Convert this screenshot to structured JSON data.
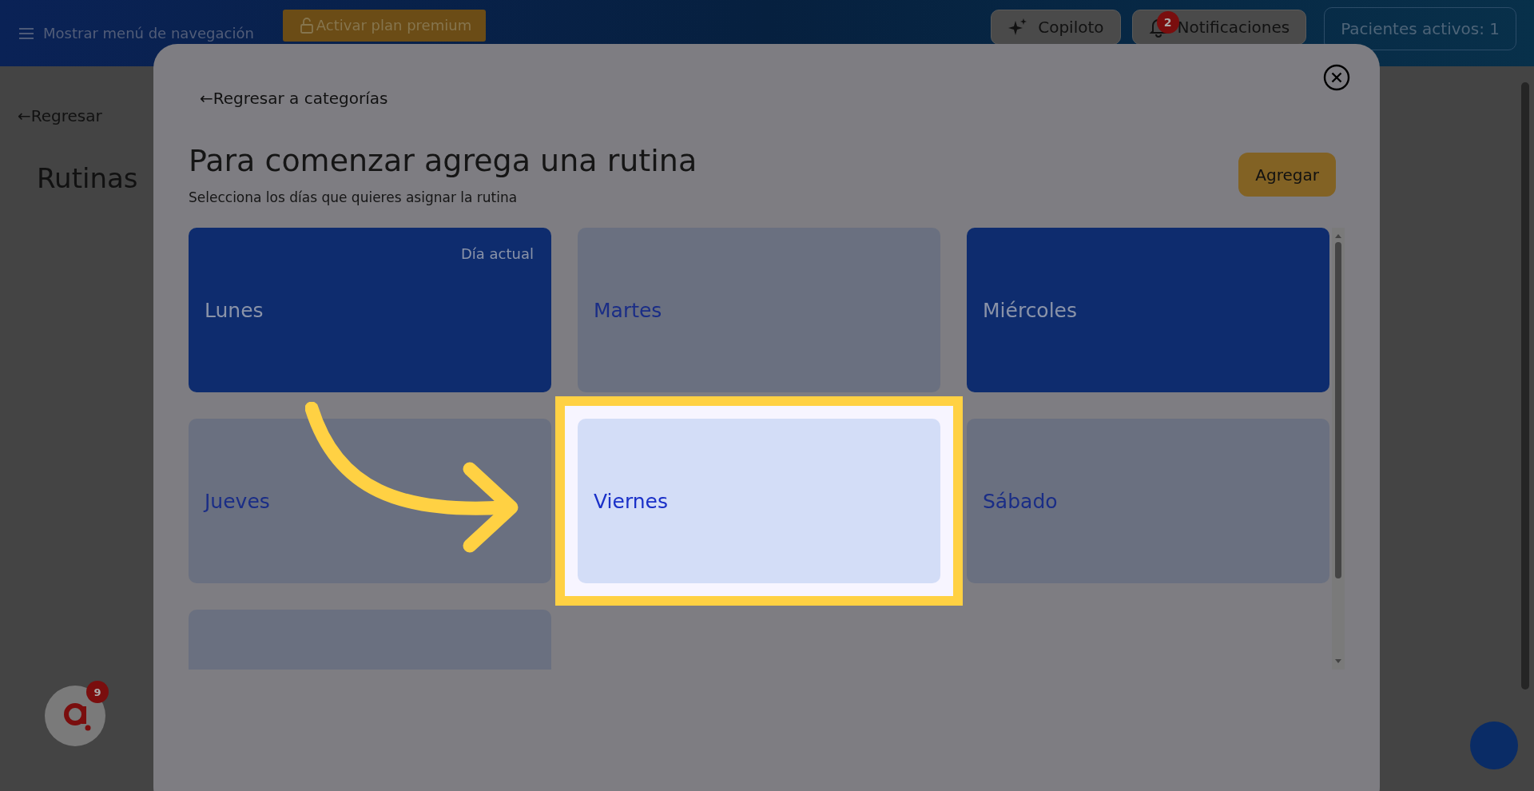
{
  "topbar": {
    "menu_label": "Mostrar menú de navegación",
    "premium_button": "Activar plan premium",
    "copilot_button": "Copiloto",
    "notifications_button": "Notificaciones",
    "notifications_count": "2",
    "patients_button": "Pacientes activos: 1"
  },
  "page": {
    "back_link": "←Regresar",
    "title": "Rutinas",
    "assistant_badge": "9"
  },
  "modal": {
    "back_link": "←Regresar a categorías",
    "title": "Para comenzar agrega una rutina",
    "subtitle": "Selecciona los días que quieres asignar la rutina",
    "add_button": "Agregar",
    "days": [
      {
        "label": "Lunes",
        "note": "Día actual",
        "selected": true,
        "highlighted": false
      },
      {
        "label": "Martes",
        "selected": false,
        "highlighted": false
      },
      {
        "label": "Miércoles",
        "selected": true,
        "highlighted": false
      },
      {
        "label": "Jueves",
        "selected": false,
        "highlighted": false
      },
      {
        "label": "Viernes",
        "selected": false,
        "highlighted": true
      },
      {
        "label": "Sábado",
        "selected": false,
        "highlighted": false
      },
      {
        "selected": false,
        "highlighted": false
      }
    ]
  }
}
